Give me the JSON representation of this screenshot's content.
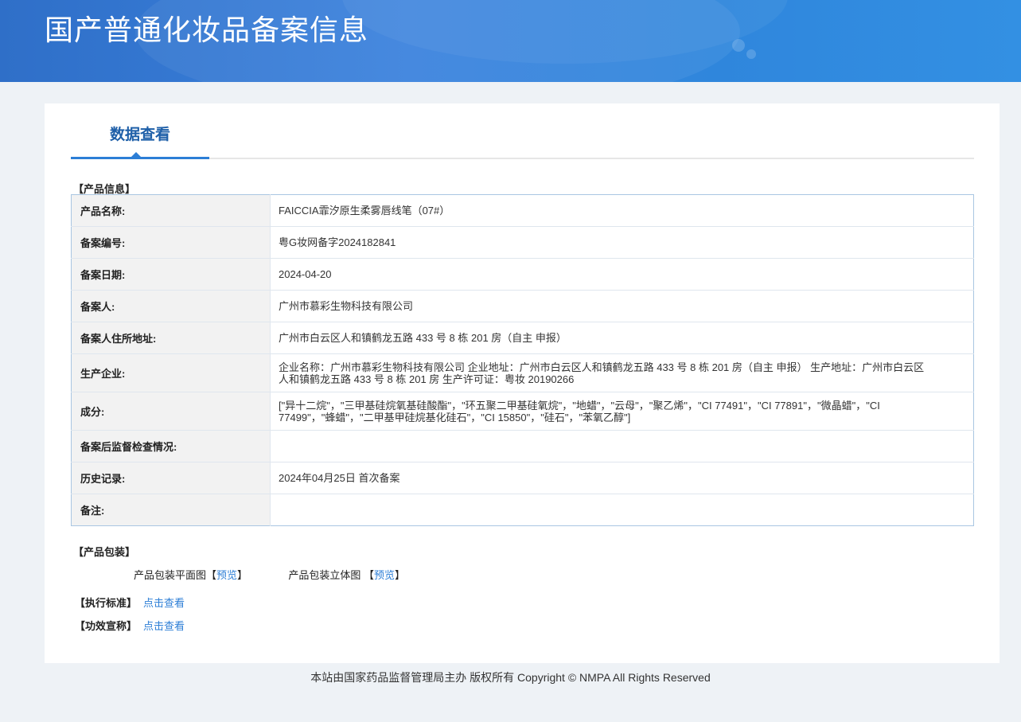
{
  "header": {
    "title": "国产普通化妆品备案信息"
  },
  "tabs": [
    {
      "label": "数据查看",
      "active": true
    }
  ],
  "sections": {
    "product_info": "【产品信息】",
    "packaging": "【产品包装】",
    "standard": "【执行标准】",
    "efficacy": "【功效宣称】"
  },
  "product_info": [
    {
      "label": "产品名称:",
      "value": "FAICCIA霏汐原生柔雾唇线笔（07#）"
    },
    {
      "label": "备案编号:",
      "value": "粤G妆网备字2024182841"
    },
    {
      "label": "备案日期:",
      "value": "2024-04-20"
    },
    {
      "label": "备案人:",
      "value": "广州市慕彩生物科技有限公司"
    },
    {
      "label": "备案人住所地址:",
      "value": "广州市白云区人和镇鹤龙五路 433 号 8 栋 201 房（自主 申报）"
    },
    {
      "label": "生产企业:",
      "value": "企业名称：广州市慕彩生物科技有限公司 企业地址：广州市白云区人和镇鹤龙五路 433 号 8 栋 201 房（自主 申报） 生产地址：广州市白云区人和镇鹤龙五路 433 号 8 栋 201 房 生产许可证：粤妆 20190266"
    },
    {
      "label": "成分:",
      "value": "[\"异十二烷\"，\"三甲基硅烷氧基硅酸酯\"，\"环五聚二甲基硅氧烷\"，\"地蜡\"，\"云母\"，\"聚乙烯\"，\"CI 77491\"，\"CI 77891\"，\"微晶蜡\"，\"CI 77499\"，\"蜂蜡\"，\"二甲基甲硅烷基化硅石\"，\"CI 15850\"，\"硅石\"，\"苯氧乙醇\"]"
    },
    {
      "label": "备案后监督检查情况:",
      "value": ""
    },
    {
      "label": "历史记录:",
      "value": "2024年04月25日 首次备案"
    },
    {
      "label": "备注:",
      "value": ""
    }
  ],
  "packaging": {
    "flat_label": "产品包装平面图",
    "flat_link": "预览",
    "solid_label": "产品包装立体图",
    "solid_link": "预览",
    "bracket_open": "【",
    "bracket_close": "】"
  },
  "standard_link": "点击查看",
  "efficacy_link": "点击查看",
  "footer": "本站由国家药品监督管理局主办 版权所有 Copyright © NMPA All Rights Reserved"
}
